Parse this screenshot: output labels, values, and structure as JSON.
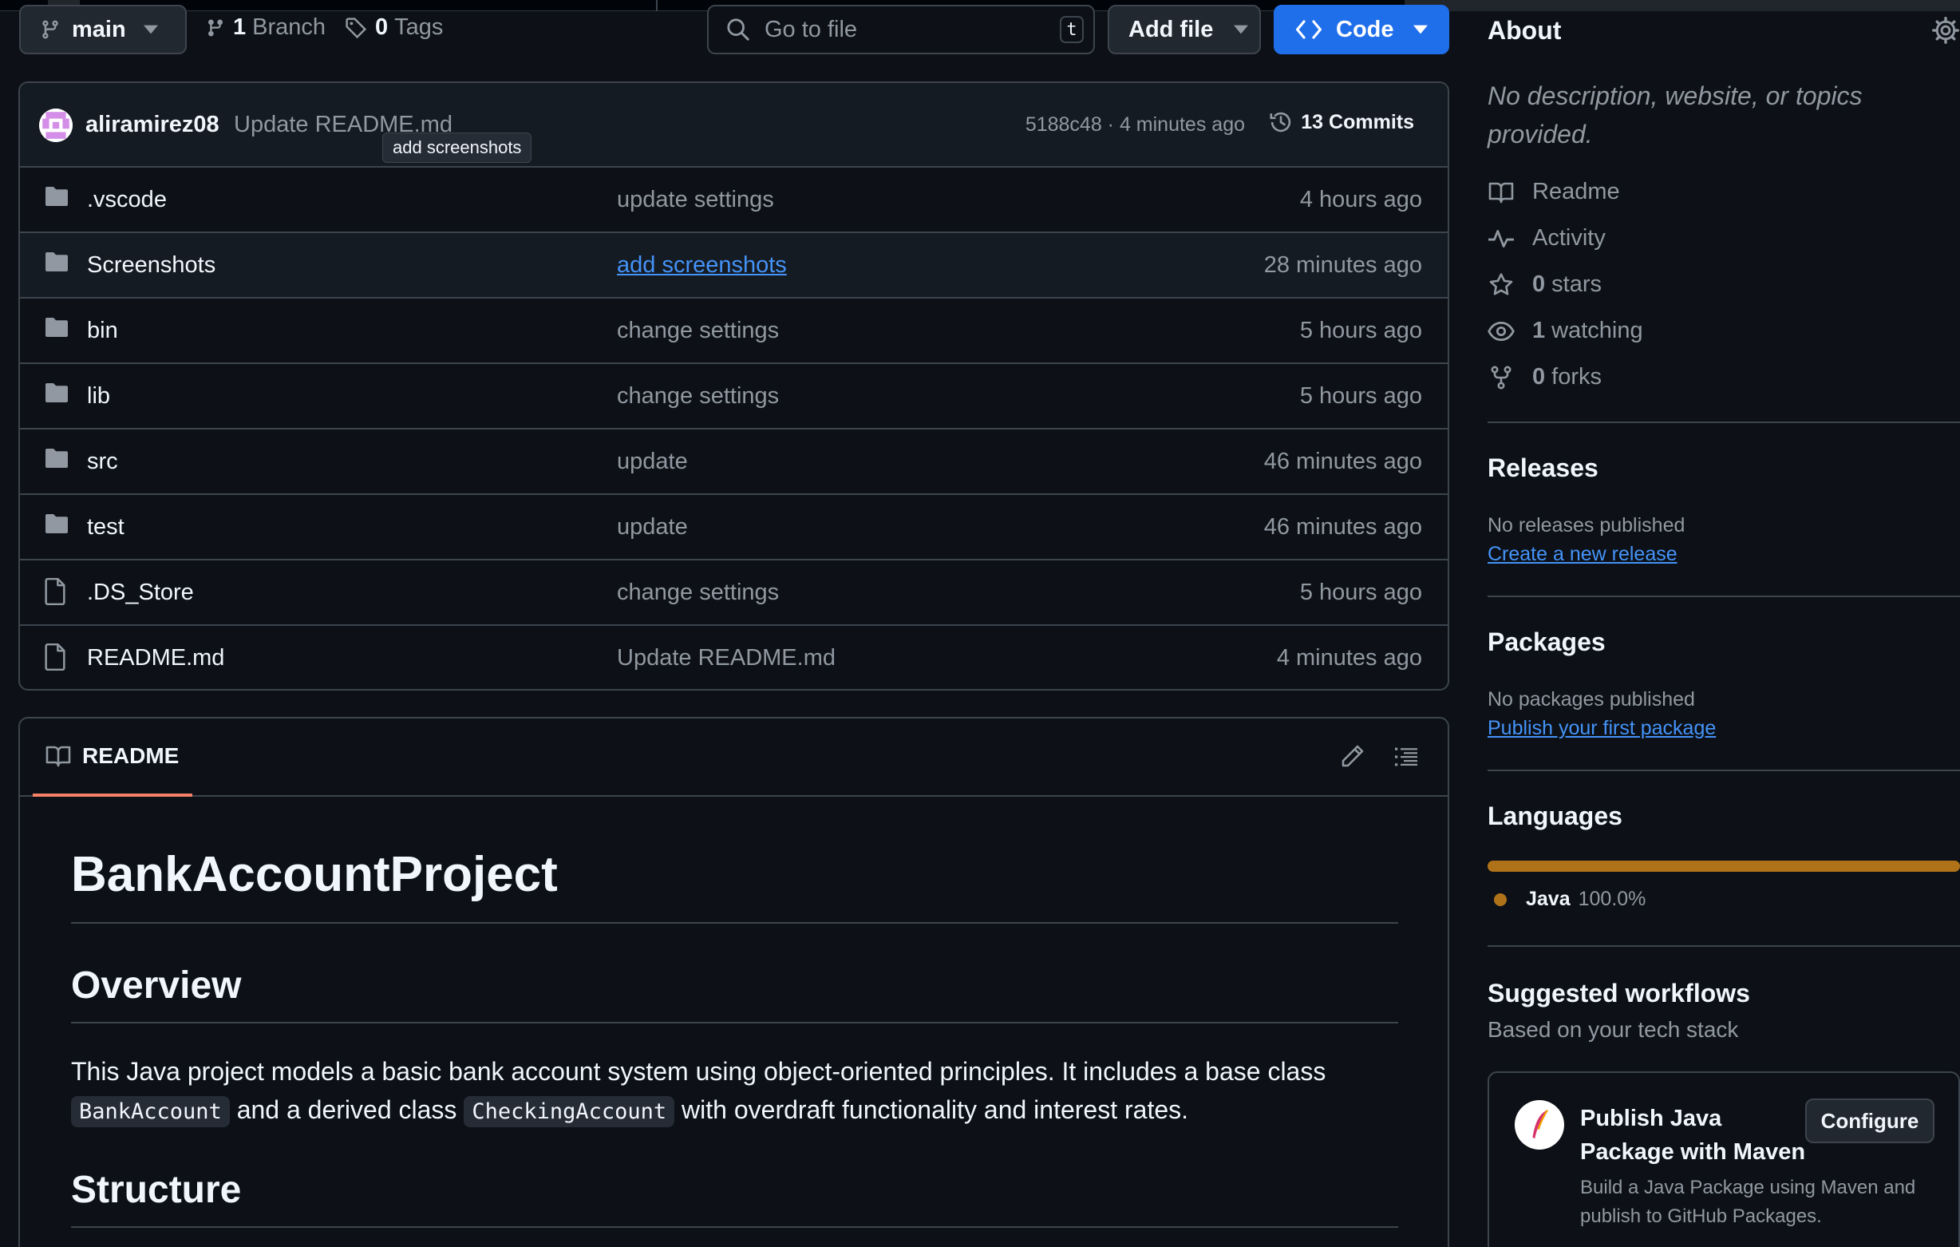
{
  "repo_header": {
    "branch_label": "main",
    "branches_count": "1",
    "branches_label": "Branch",
    "tags_count": "0",
    "tags_label": "Tags",
    "search_placeholder": "Go to file",
    "search_shortcut": "t",
    "add_file_label": "Add file",
    "code_label": "Code"
  },
  "latest_commit": {
    "author": "aliramirez08",
    "message": "Update README.md",
    "tooltip": "add screenshots",
    "hash_time": "5188c48 · 4 minutes ago",
    "commits_label": "13 Commits"
  },
  "files": [
    {
      "type": "folder",
      "name": ".vscode",
      "message": "update settings",
      "time": "4 hours ago"
    },
    {
      "type": "folder",
      "name": "Screenshots",
      "message": "add screenshots",
      "time": "28 minutes ago"
    },
    {
      "type": "folder",
      "name": "bin",
      "message": "change settings",
      "time": "5 hours ago"
    },
    {
      "type": "folder",
      "name": "lib",
      "message": "change settings",
      "time": "5 hours ago"
    },
    {
      "type": "folder",
      "name": "src",
      "message": "update",
      "time": "46 minutes ago"
    },
    {
      "type": "folder",
      "name": "test",
      "message": "update",
      "time": "46 minutes ago"
    },
    {
      "type": "file",
      "name": ".DS_Store",
      "message": "change settings",
      "time": "5 hours ago"
    },
    {
      "type": "file",
      "name": "README.md",
      "message": "Update README.md",
      "time": "4 minutes ago"
    }
  ],
  "readme": {
    "tab_label": "README",
    "h1": "BankAccountProject",
    "h2_overview": "Overview",
    "p_part1": "This Java project models a basic bank account system using object-oriented principles. It includes a base class ",
    "code1": "BankAccount",
    "p_part2": " and a derived class ",
    "code2": "CheckingAccount",
    "p_part3": " with overdraft functionality and interest rates.",
    "h2_structure": "Structure"
  },
  "sidebar": {
    "about_title": "About",
    "about_desc": "No description, website, or topics provided.",
    "readme_label": "Readme",
    "activity_label": "Activity",
    "stars_count": "0",
    "stars_label": "stars",
    "watching_count": "1",
    "watching_label": "watching",
    "forks_count": "0",
    "forks_label": "forks",
    "releases_title": "Releases",
    "releases_none": "No releases published",
    "releases_link": "Create a new release",
    "packages_title": "Packages",
    "packages_none": "No packages published",
    "packages_link": "Publish your first package",
    "languages_title": "Languages",
    "language_name": "Java",
    "language_pct": "100.0%",
    "language_fraction": 1.0,
    "language_color": "#b07219",
    "workflows_title": "Suggested workflows",
    "workflows_sub": "Based on your tech stack",
    "workflow_title": "Publish Java Package with Maven",
    "workflow_button": "Configure",
    "workflow_desc": "Build a Java Package using Maven and publish to GitHub Packages."
  },
  "colors": {
    "accent": "#1f6feb",
    "link": "#4493f8",
    "tab_underline": "#f78166"
  }
}
